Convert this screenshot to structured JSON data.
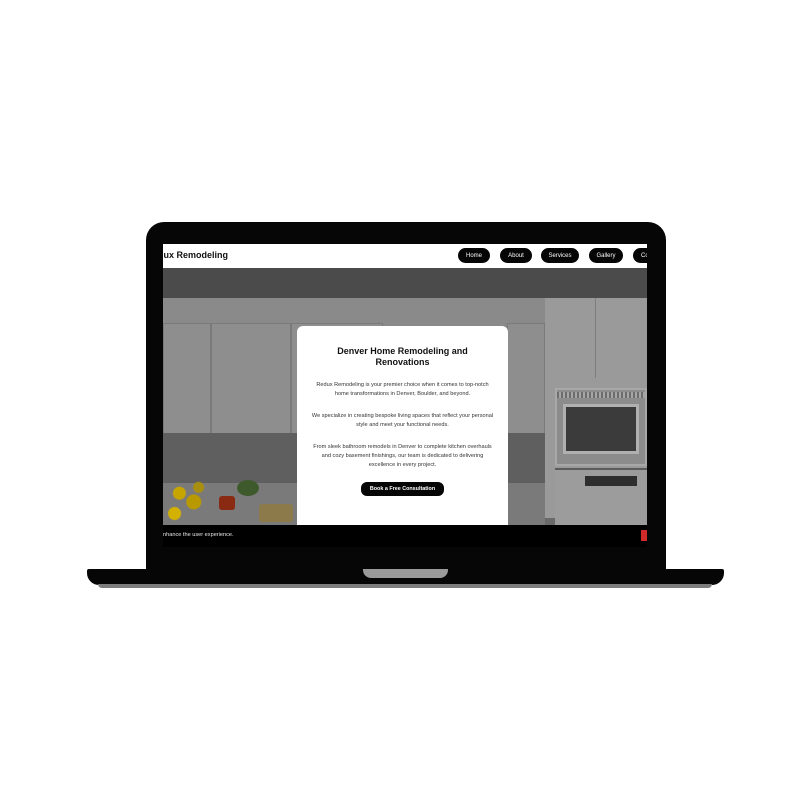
{
  "site": {
    "brand": "lux Remodeling",
    "nav": [
      {
        "label": "Home"
      },
      {
        "label": "About"
      },
      {
        "label": "Services"
      },
      {
        "label": "Gallery"
      },
      {
        "label": "Co"
      }
    ]
  },
  "hero_card": {
    "title": "Denver Home Remodeling and Renovations",
    "paragraphs": [
      "Redux Remodeling is your premier choice when it comes to top-notch home transformations in Denver, Boulder, and beyond.",
      "We specialize in creating bespoke living spaces that reflect your personal style and meet your functional needs.",
      "From sleek bathroom remodels in Denver to complete kitchen overhauls and cozy basement finishings, our team is dedicated to delivering excellence in every project."
    ],
    "cta_label": "Book a Free Consultation"
  },
  "cookie_bar": {
    "text": "nhance the user experience."
  },
  "colors": {
    "accent_red": "#d12a2a",
    "button_black": "#050505",
    "laptop_body": "#060606"
  }
}
